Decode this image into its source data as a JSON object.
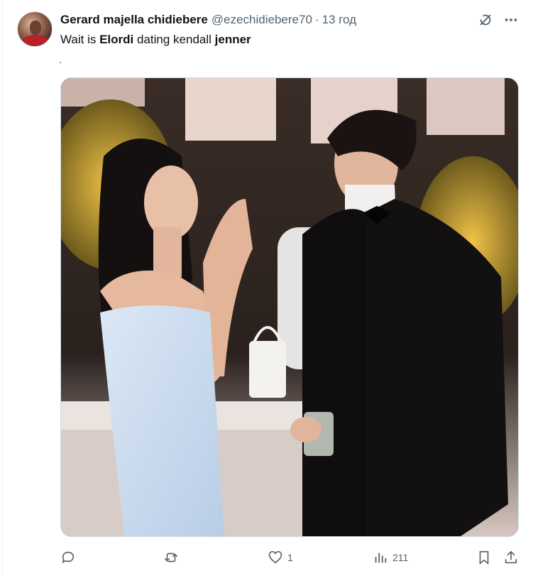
{
  "tweet": {
    "author": {
      "display_name": "Gerard majella chidiebere",
      "handle": "@ezechidiebere70",
      "separator": "·",
      "time": "13 год"
    },
    "text": {
      "part1": "Wait is ",
      "bold1": "Elordi",
      "part2": " dating kendall ",
      "bold2": "jenner"
    },
    "media": {
      "description_icon": "photo"
    },
    "actions": {
      "reply_count": "",
      "retweet_count": "",
      "like_count": "1",
      "views_count": "211"
    }
  },
  "icons": {
    "grok": "grok-icon",
    "more": "more-icon",
    "reply": "reply-icon",
    "retweet": "retweet-icon",
    "like": "heart-icon",
    "views": "views-icon",
    "bookmark": "bookmark-icon",
    "share": "share-icon"
  },
  "colors": {
    "text": "#0f1419",
    "secondary": "#536471",
    "border": "#cfd9de"
  }
}
